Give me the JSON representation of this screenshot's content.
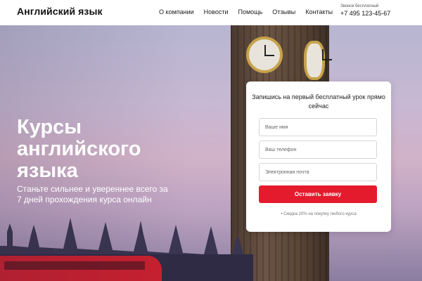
{
  "header": {
    "logo": "Английский язык",
    "nav": [
      "О компании",
      "Новости",
      "Помощь",
      "Отзывы",
      "Контакты"
    ],
    "contact_label": "Звонок бесплатный",
    "phone": "+7 495 123-45-67"
  },
  "hero": {
    "title": "Курсы английского языка",
    "subtitle": "Станьте сильнее и увереннее всего за 7 дней прохождения курса онлайн"
  },
  "form": {
    "title": "Запишись на первый бесплатный урок прямо сейчас",
    "name_placeholder": "Ваше имя",
    "phone_placeholder": "Ваш телефон",
    "email_placeholder": "Электронная почта",
    "submit_label": "Оставить заявку",
    "note": "• Скидка 20% на покупку любого курса"
  },
  "colors": {
    "accent": "#e41b2d",
    "text": "#111111"
  }
}
